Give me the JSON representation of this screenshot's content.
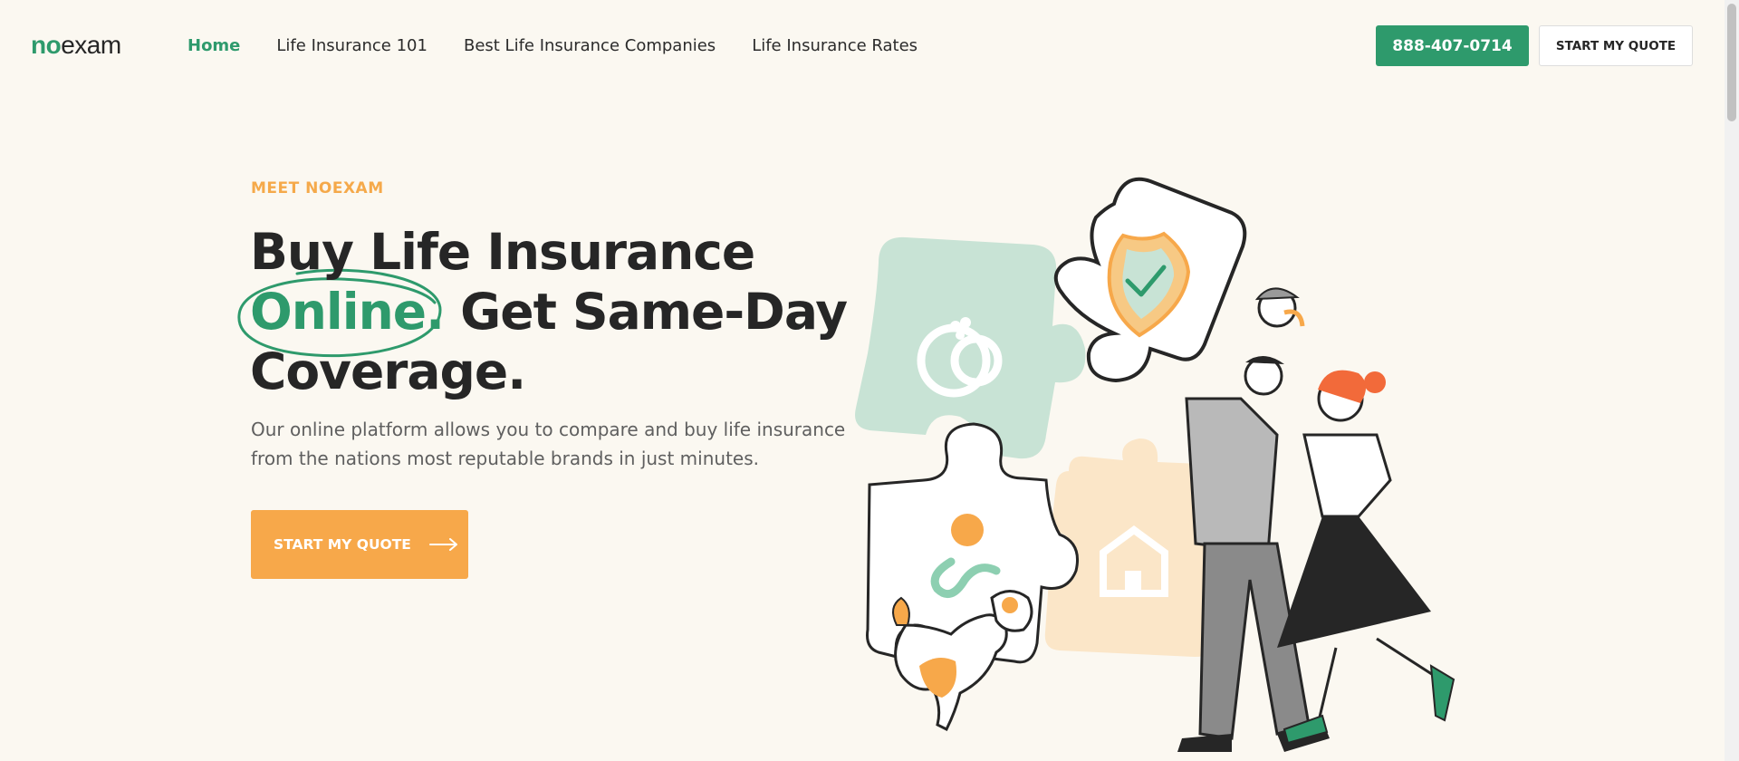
{
  "logo": {
    "part1": "no",
    "part2": "exam"
  },
  "nav": {
    "items": [
      {
        "label": "Home",
        "active": true
      },
      {
        "label": "Life Insurance 101",
        "active": false
      },
      {
        "label": "Best Life Insurance Companies",
        "active": false
      },
      {
        "label": "Life Insurance Rates",
        "active": false
      }
    ]
  },
  "header": {
    "phone": "888-407-0714",
    "quote_label": "START MY QUOTE"
  },
  "hero": {
    "eyebrow": "MEET NOEXAM",
    "headline_line1": "Buy Life Insurance",
    "headline_highlight": "Online.",
    "headline_line2_rest": " Get Same-Day",
    "headline_line3": "Coverage.",
    "subtext": "Our online platform allows you to compare and buy life insurance from the nations most reputable brands in just minutes.",
    "cta_label": "START MY QUOTE"
  },
  "colors": {
    "brand_green": "#2e9a6c",
    "accent_orange": "#f7a84a",
    "background": "#fbf8f1"
  },
  "icons": {
    "cta_arrow": "arrow-right-icon"
  }
}
